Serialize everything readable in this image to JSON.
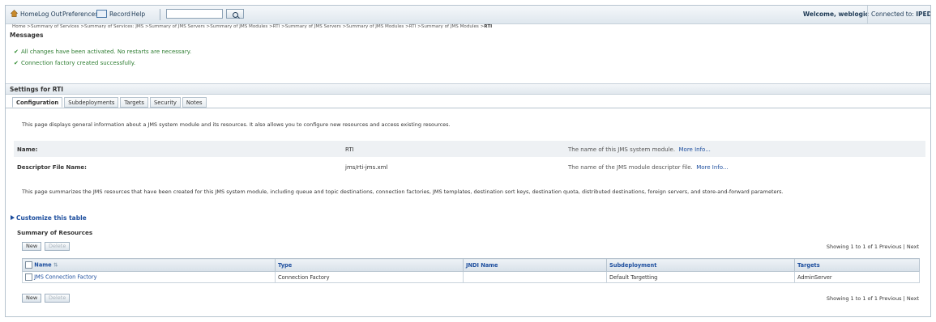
{
  "toolbar": {
    "home": "Home",
    "logout": "Log Out",
    "preferences": "Preferences",
    "record": "Record",
    "help": "Help",
    "search_value": "",
    "welcome": "Welcome, weblogic",
    "connected_prefix": "Connected to: ",
    "connected_domain": "IPEDOM"
  },
  "breadcrumb": {
    "path": "Home >Summary of Services >Summary of Services: JMS >Summary of JMS Servers >Summary of JMS Modules >RTI >Summary of JMS Servers >Summary of JMS Modules >RTI >Summary of JMS Modules >",
    "current": "RTI"
  },
  "messages": {
    "title": "Messages",
    "items": [
      "All changes have been activated. No restarts are necessary.",
      "Connection factory created successfully."
    ]
  },
  "settings": {
    "title": "Settings for RTI",
    "tabs": [
      "Configuration",
      "Subdeployments",
      "Targets",
      "Security",
      "Notes"
    ],
    "intro": "This page displays general information about a JMS system module and its resources. It also allows you to configure new resources and access existing resources.",
    "fields": [
      {
        "label": "Name:",
        "value": "RTI",
        "hint": "The name of this JMS system module.",
        "more": "More Info..."
      },
      {
        "label": "Descriptor File Name:",
        "value": "jms/rti-jms.xml",
        "hint": "The name of the JMS module descriptor file.",
        "more": "More Info..."
      }
    ],
    "summary_text": "This page summarizes the JMS resources that have been created for this JMS system module, including queue and topic destinations, connection factories, JMS templates, destination sort keys, destination quota, distributed destinations, foreign servers, and store-and-forward parameters."
  },
  "resources": {
    "customize": "Customize this table",
    "title": "Summary of Resources",
    "new_label": "New",
    "delete_label": "Delete",
    "paging": "Showing 1 to 1 of 1   Previous | Next",
    "columns": [
      "Name",
      "Type",
      "JNDI Name",
      "Subdeployment",
      "Targets"
    ],
    "rows": [
      [
        "JMS Connection Factory",
        "Connection Factory",
        "",
        "Default Targetting",
        "AdminServer"
      ]
    ]
  }
}
